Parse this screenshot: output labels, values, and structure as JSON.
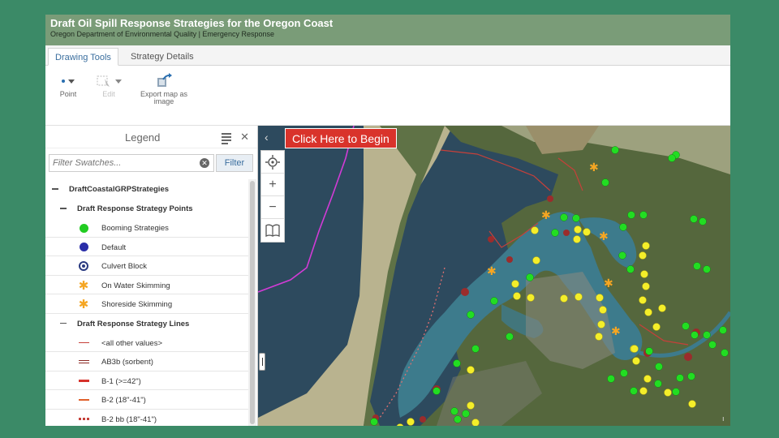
{
  "header": {
    "title": "Draft Oil Spill Response Strategies for the Oregon Coast",
    "subtitle": "Oregon Department of Environmental Quality | Emergency Response"
  },
  "tabs": [
    {
      "label": "Drawing Tools",
      "active": true
    },
    {
      "label": "Strategy Details",
      "active": false
    }
  ],
  "toolbar": {
    "point_label": "Point",
    "edit_label": "Edit",
    "export_label_1": "Export map as",
    "export_label_2": "image"
  },
  "legend": {
    "title": "Legend",
    "filter_placeholder": "Filter Swatches...",
    "filter_button": "Filter",
    "root": "DraftCoastalGRPStrategies",
    "points_group": "Draft Response Strategy Points",
    "points": [
      {
        "label": "Booming Strategies",
        "icon": "green-dot"
      },
      {
        "label": "Default",
        "icon": "blue-dot"
      },
      {
        "label": "Culvert Block",
        "icon": "culvert-block"
      },
      {
        "label": "On Water Skimming",
        "icon": "orange-burst"
      },
      {
        "label": "Shoreside Skimming",
        "icon": "orange-burst"
      }
    ],
    "lines_group": "Draft Response Strategy Lines",
    "lines": [
      {
        "label": "<all other values>",
        "icon": "thin-red-line"
      },
      {
        "label": "AB3b (sorbent)",
        "icon": "double-red-line"
      },
      {
        "label": "B-1 (>=42\")",
        "icon": "thick-red-line"
      },
      {
        "label": "B-2 (18\"-41\")",
        "icon": "orange-red-line"
      },
      {
        "label": "B-2 bb (18\"-41\")",
        "icon": "dotted-red-line"
      }
    ]
  },
  "map": {
    "begin_button": "Click Here to Begin",
    "zoom_in": "+",
    "zoom_out": "−"
  },
  "colors": {
    "booming": "#22dd22",
    "skimming_point": "#f4ee2a",
    "boom_line": "#c6403a",
    "boundary": "#d23bd6",
    "begin": "#d9332b"
  }
}
